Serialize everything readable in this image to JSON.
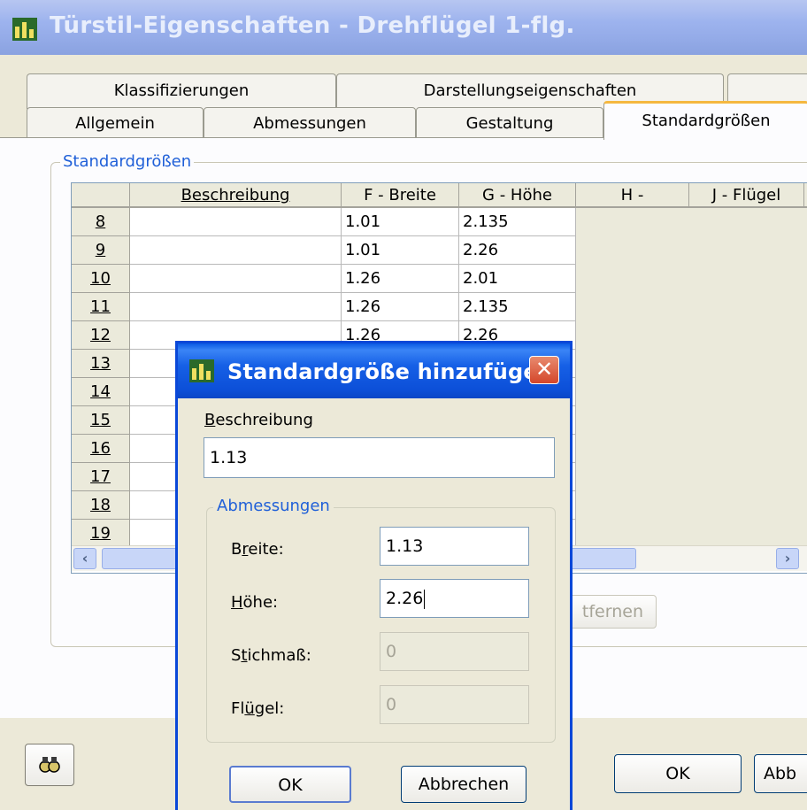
{
  "window": {
    "title": "Türstil-Eigenschaften - Drehflügel 1-flg."
  },
  "tabs_back": [
    {
      "label": "Klassifizierungen"
    },
    {
      "label": "Darstellungseigenschaften"
    },
    {
      "label": ""
    }
  ],
  "tabs_front": [
    {
      "label": "Allgemein"
    },
    {
      "label": "Abmessungen"
    },
    {
      "label": "Gestaltung"
    },
    {
      "label": "Standardgrößen",
      "active": true
    }
  ],
  "group": {
    "label": "Standardgrößen"
  },
  "grid": {
    "columns": [
      "",
      "Beschreibung",
      "F - Breite",
      "G - Höhe",
      "H -",
      "J - Flügel"
    ],
    "rows": [
      {
        "num": "8",
        "desc": "",
        "breite": "1.01",
        "hoehe": "2.135"
      },
      {
        "num": "9",
        "desc": "",
        "breite": "1.01",
        "hoehe": "2.26"
      },
      {
        "num": "10",
        "desc": "",
        "breite": "1.26",
        "hoehe": "2.01"
      },
      {
        "num": "11",
        "desc": "",
        "breite": "1.26",
        "hoehe": "2.135"
      },
      {
        "num": "12",
        "desc": "",
        "breite": "1.26",
        "hoehe": "2.26"
      },
      {
        "num": "13",
        "desc": "",
        "breite": "",
        "hoehe": ""
      },
      {
        "num": "14",
        "desc": "",
        "breite": "",
        "hoehe": ""
      },
      {
        "num": "15",
        "desc": "",
        "breite": "",
        "hoehe": ""
      },
      {
        "num": "16",
        "desc": "",
        "breite": "",
        "hoehe": ""
      },
      {
        "num": "17",
        "desc": "",
        "breite": "",
        "hoehe": ""
      },
      {
        "num": "18",
        "desc": "",
        "breite": "",
        "hoehe": ""
      },
      {
        "num": "19",
        "desc": "",
        "breite": "",
        "hoehe": ""
      }
    ]
  },
  "main_buttons": {
    "remove_partial": "tfernen",
    "ok": "OK",
    "cancel_partial": "Abb"
  },
  "dialog": {
    "title": "Standardgröße hinzufügen",
    "beschreibung_label": "Beschreibung",
    "beschreibung_value": "1.13",
    "group_label": "Abmessungen",
    "breite_label": "Breite:",
    "breite_value": "1.13",
    "hoehe_label": "Höhe:",
    "hoehe_value": "2.26",
    "stichmass_label": "Stichmaß:",
    "stichmass_value": "0",
    "fluegel_label": "Flügel:",
    "fluegel_value": "0",
    "ok": "OK",
    "cancel": "Abbrechen"
  },
  "colors": {
    "dialog_title": "#0c4fd8",
    "active_tab_accent": "#f5b840",
    "group_label": "#2060d8"
  }
}
